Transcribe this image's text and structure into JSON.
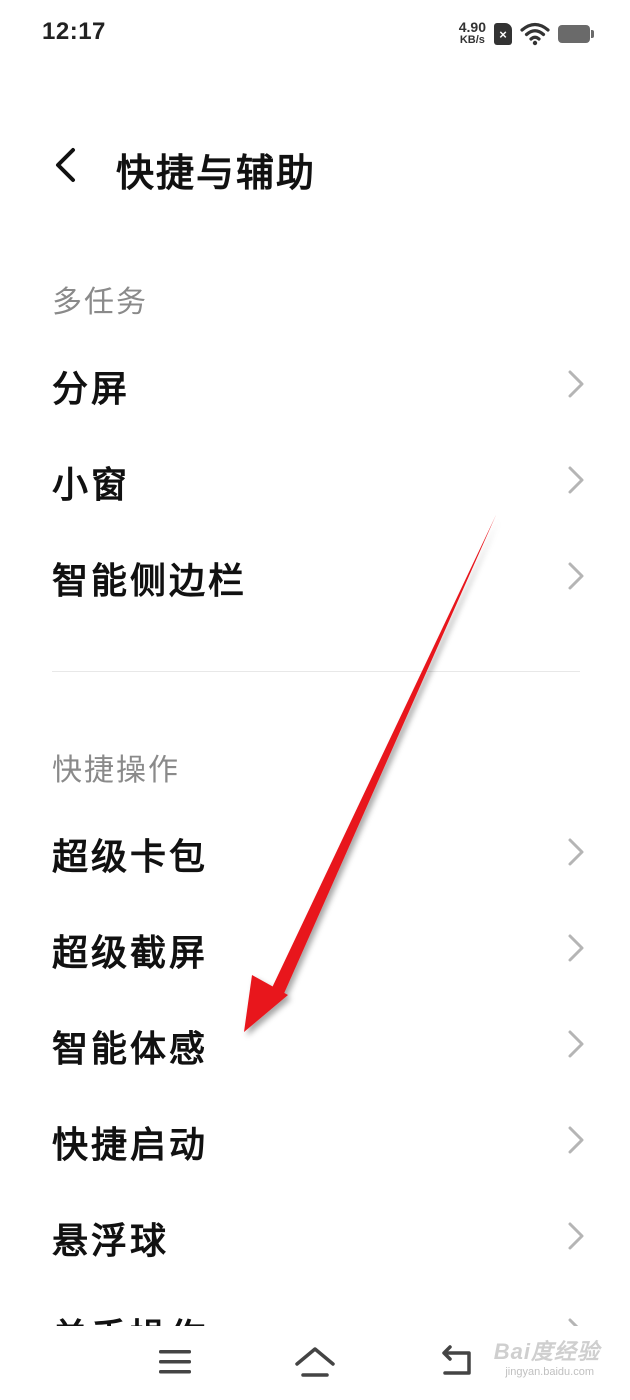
{
  "status_bar": {
    "time": "12:17",
    "net_speed_value": "4.90",
    "net_speed_unit": "KB/s",
    "sim_icon_text": "×"
  },
  "header": {
    "title": "快捷与辅助"
  },
  "sections": [
    {
      "label": "多任务",
      "items": [
        {
          "label": "分屏"
        },
        {
          "label": "小窗"
        },
        {
          "label": "智能侧边栏"
        }
      ]
    },
    {
      "label": "快捷操作",
      "items": [
        {
          "label": "超级卡包"
        },
        {
          "label": "超级截屏"
        },
        {
          "label": "智能体感"
        },
        {
          "label": "快捷启动"
        },
        {
          "label": "悬浮球"
        },
        {
          "label": "单手操作"
        }
      ]
    }
  ],
  "watermark": {
    "main": "Bai度经验",
    "sub": "jingyan.baidu.com"
  },
  "icons": {
    "back": "chevron-left-icon",
    "row_arrow": "chevron-right-icon",
    "nav_menu": "menu-icon",
    "nav_home": "home-icon",
    "nav_back": "return-icon",
    "wifi": "wifi-icon",
    "battery": "battery-icon"
  },
  "colors": {
    "annotation_arrow": "#e8141c",
    "section_label": "#8a8a8a",
    "chevron": "#b5b5b5"
  }
}
